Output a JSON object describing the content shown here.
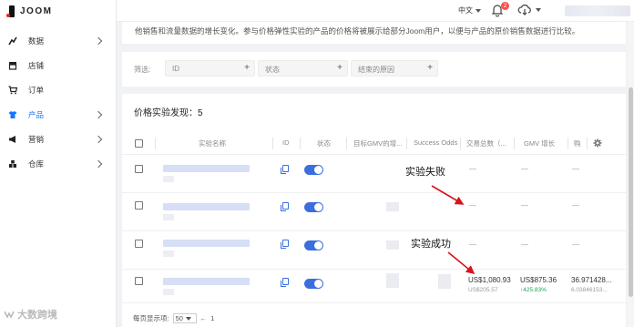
{
  "app": {
    "logo_text": "JOOM"
  },
  "sidebar": {
    "items": [
      {
        "label": "数据",
        "icon": "trend-chart-icon",
        "has_children": true
      },
      {
        "label": "店铺",
        "icon": "store-icon",
        "has_children": false
      },
      {
        "label": "订单",
        "icon": "cart-icon",
        "has_children": false
      },
      {
        "label": "产品",
        "icon": "shirt-icon",
        "has_children": true,
        "active": true
      },
      {
        "label": "营销",
        "icon": "megaphone-icon",
        "has_children": true
      },
      {
        "label": "仓库",
        "icon": "warehouse-icon",
        "has_children": true
      }
    ],
    "active_color": "#1677ff"
  },
  "topbar": {
    "language": "中文",
    "notification_count": "2"
  },
  "description": {
    "text": "他销售和流量数据的增长变化。参与价格弹性实验的产品的价格将被展示给部分Joom用户，以便与产品的原价销售数据进行比较。"
  },
  "filters": {
    "label": "筛选:",
    "fields": [
      {
        "placeholder": "ID",
        "plus": "+"
      },
      {
        "placeholder": "状态",
        "plus": "+"
      },
      {
        "placeholder": "结束的原因",
        "plus": "+"
      }
    ]
  },
  "table": {
    "title": "价格实验发现：5",
    "columns": [
      "实验名称",
      "ID",
      "状态",
      "目标GMV的增...",
      "Success Odds",
      "交易总数（...",
      "GMV 增长",
      "购"
    ],
    "rows": [
      {
        "trans": "—",
        "gmv": "—",
        "extra": "—"
      },
      {
        "trans": "—",
        "gmv": "—",
        "extra": "—"
      },
      {
        "trans": "—",
        "gmv": "—",
        "extra": "—"
      },
      {
        "trans": "US$1,080.93",
        "trans_sub": "US$205.57",
        "gmv": "US$875.36",
        "gmv_sub": "↑425.83%",
        "extra": "36.971428...",
        "extra_sub": "6.03846153..."
      }
    ],
    "accent": "#3b6fe0"
  },
  "annotations": {
    "fail": "实验失败",
    "success": "实验成功"
  },
  "pager": {
    "label": "每页显示项:",
    "page_size": "50",
    "page_num": "1",
    "prev": "←"
  },
  "watermark": "大数跨境"
}
